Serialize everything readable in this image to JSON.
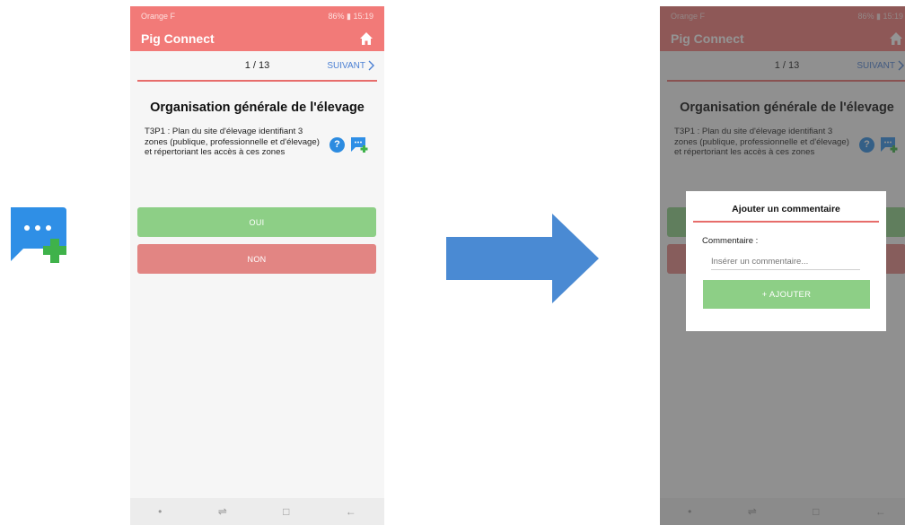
{
  "status": {
    "carrier": "Orange F",
    "indicators": "86%",
    "time": "15:19"
  },
  "app": {
    "title": "Pig Connect",
    "home_icon": "home-icon"
  },
  "pager": {
    "count": "1 / 13",
    "next_label": "SUIVANT"
  },
  "section": {
    "heading": "Organisation générale de l'élevage",
    "question": "T3P1 : Plan du site d'élevage identifiant 3 zones (publique, professionnelle et d'élevage) et répertoriant les accès à ces zones"
  },
  "answers": {
    "yes": "OUI",
    "no": "NON"
  },
  "dialog": {
    "title": "Ajouter un commentaire",
    "label": "Commentaire :",
    "placeholder": "Insérer un commentaire...",
    "submit": "+ AJOUTER"
  },
  "colors": {
    "accent": "#f27a78",
    "yes": "#8dcf86",
    "no": "#e28583",
    "link": "#4a7fd3",
    "arrow": "#4a8ad3"
  }
}
